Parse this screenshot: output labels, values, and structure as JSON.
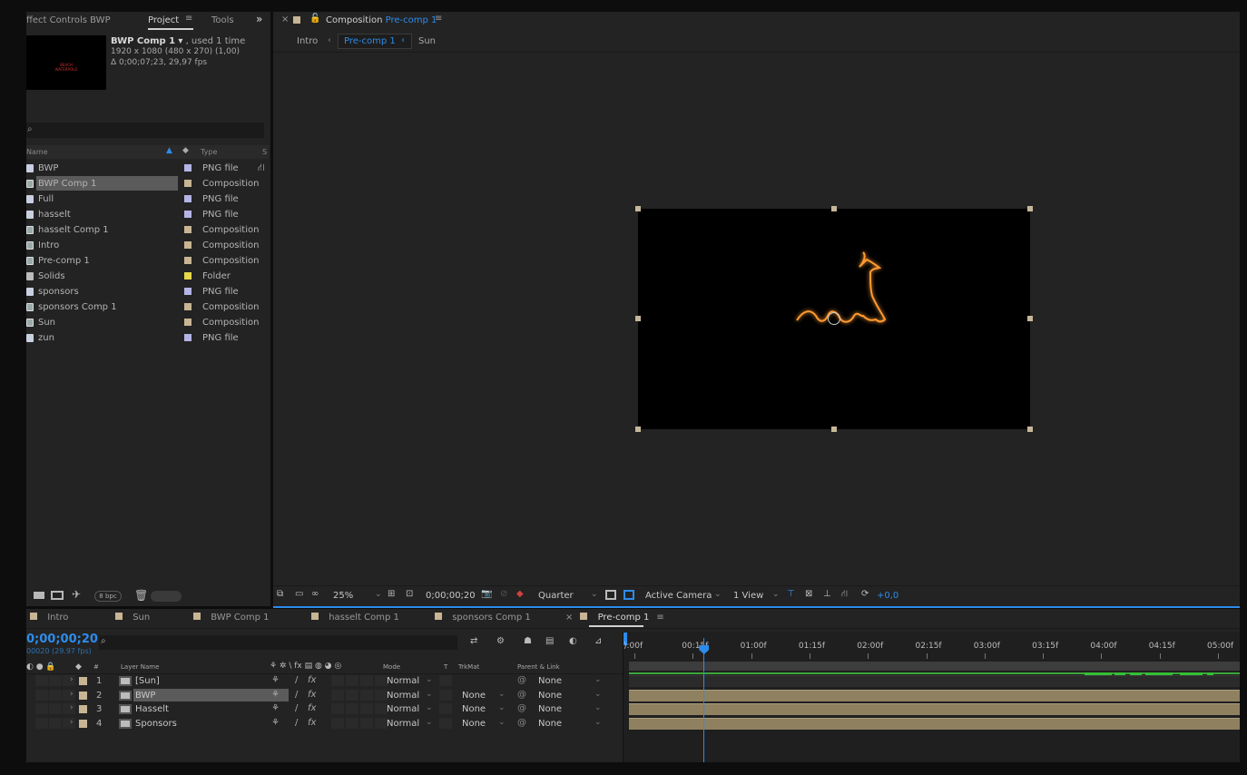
{
  "project_panel": {
    "tabs": [
      "ffect Controls BWP",
      "Project",
      "Tools"
    ],
    "more": "»",
    "preview": {
      "name": "BWP Comp 1",
      "used": ", used 1 time",
      "dims": "1920 x 1080  (480 x 270) (1,00)",
      "duration": "Δ 0;00;07;23, 29,97 fps",
      "thumb_text": "BEACH WATERPOLO"
    },
    "search_icon": "search-icon",
    "columns": {
      "name": "Name",
      "type": "Type",
      "size": "S"
    },
    "items": [
      {
        "name": "BWP",
        "type": "PNG file",
        "label_color": "#b4b4e6",
        "icon": "png-file-icon"
      },
      {
        "name": "BWP Comp 1",
        "type": "Composition",
        "label_color": "#c8b594",
        "icon": "composition-icon",
        "selected": true
      },
      {
        "name": "Full",
        "type": "PNG file",
        "label_color": "#b4b4e6",
        "icon": "png-file-icon"
      },
      {
        "name": "hasselt",
        "type": "PNG file",
        "label_color": "#b4b4e6",
        "icon": "png-file-icon"
      },
      {
        "name": "hasselt Comp 1",
        "type": "Composition",
        "label_color": "#c8b594",
        "icon": "composition-icon"
      },
      {
        "name": "Intro",
        "type": "Composition",
        "label_color": "#c8b594",
        "icon": "composition-icon"
      },
      {
        "name": "Pre-comp 1",
        "type": "Composition",
        "label_color": "#c8b594",
        "icon": "composition-icon"
      },
      {
        "name": "Solids",
        "type": "Folder",
        "label_color": "#e5d84a",
        "icon": "folder-icon"
      },
      {
        "name": "sponsors",
        "type": "PNG file",
        "label_color": "#b4b4e6",
        "icon": "png-file-icon"
      },
      {
        "name": "sponsors Comp 1",
        "type": "Composition",
        "label_color": "#c8b594",
        "icon": "composition-icon"
      },
      {
        "name": "Sun",
        "type": "Composition",
        "label_color": "#c8b594",
        "icon": "composition-icon"
      },
      {
        "name": "zun",
        "type": "PNG file",
        "label_color": "#b4b4e6",
        "icon": "png-file-icon"
      }
    ],
    "bpc": "8 bpc"
  },
  "composition_panel": {
    "title_prefix": "Composition",
    "title_name": "Pre-comp 1",
    "breadcrumbs": [
      "Intro",
      "Pre-comp 1",
      "Sun"
    ],
    "zoom": "25%",
    "timecode": "0;00;00;20",
    "resolution": "Quarter",
    "camera": "Active Camera",
    "views": "1 View",
    "exposure": "+0,0"
  },
  "timeline": {
    "tabs": [
      "Intro",
      "Sun",
      "BWP Comp 1",
      "hasselt Comp 1",
      "sponsors Comp 1",
      "Pre-comp 1"
    ],
    "tab_colors": [
      "#c8b594",
      "#c8b594",
      "#c8b594",
      "#c8b594",
      "#c8b594",
      "#c8b594"
    ],
    "current_time": "0;00;00;20",
    "fps": "00020 (29.97 fps)",
    "columns": {
      "num": "#",
      "layer_name": "Layer Name",
      "mode": "Mode",
      "t": "T",
      "trkmat": "TrkMat",
      "parent": "Parent & Link"
    },
    "layers": [
      {
        "num": "1",
        "name": "[Sun]",
        "mode": "Normal",
        "trkmat": "",
        "parent": "None"
      },
      {
        "num": "2",
        "name": "BWP",
        "mode": "Normal",
        "trkmat": "None",
        "parent": "None",
        "selected": true
      },
      {
        "num": "3",
        "name": "Hasselt",
        "mode": "Normal",
        "trkmat": "None",
        "parent": "None"
      },
      {
        "num": "4",
        "name": "Sponsors",
        "mode": "Normal",
        "trkmat": "None",
        "parent": "None"
      }
    ],
    "ruler": [
      "):00f",
      "00:15f",
      "01:00f",
      "01:15f",
      "02:00f",
      "02:15f",
      "03:00f",
      "03:15f",
      "04:00f",
      "04:15f",
      "05:00f"
    ],
    "playhead_fraction": 0.13
  }
}
